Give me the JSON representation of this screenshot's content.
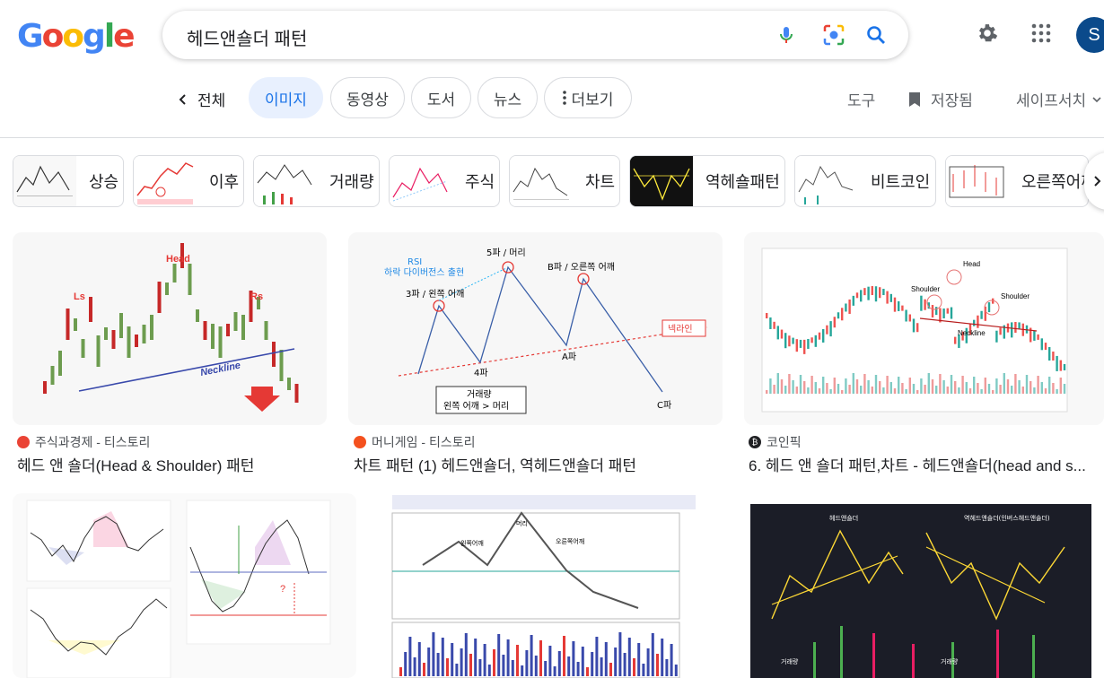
{
  "logo": {
    "letters": [
      "G",
      "o",
      "o",
      "g",
      "l",
      "e"
    ],
    "colors": [
      "#4285f4",
      "#ea4335",
      "#fbbc05",
      "#4285f4",
      "#34a853",
      "#ea4335"
    ]
  },
  "search": {
    "query": "헤드앤숄더 패턴"
  },
  "account": {
    "initial": "S",
    "color": "#0b4a8b"
  },
  "tabs": {
    "back_label": "전체",
    "items": [
      {
        "label": "이미지",
        "active": true
      },
      {
        "label": "동영상"
      },
      {
        "label": "도서"
      },
      {
        "label": "뉴스"
      },
      {
        "label": "더보기"
      }
    ],
    "tools": "도구",
    "saved": "저장됨",
    "safesearch": "세이프서치"
  },
  "chips": [
    "상승",
    "이후",
    "거래량",
    "주식",
    "차트",
    "역헤숄패턴",
    "비트코인",
    "오른쪽어깨"
  ],
  "results": [
    {
      "source": "주식과경제 - 티스토리",
      "title": "헤드 앤 숄더(Head & Shoulder) 패턴",
      "favicon_color": "#ea4335",
      "labels": {
        "head": "Head",
        "ls": "Ls",
        "rs": "Rs",
        "neckline": "Neckline"
      }
    },
    {
      "source": "머니게임 - 티스토리",
      "title": "차트 패턴 (1) 헤드앤숄더, 역헤드앤숄더 패턴",
      "favicon_color": "#f4511e",
      "labels": {
        "wave5": "5파 / 머리",
        "rsi": "RSI",
        "divergence": "하락 다이버전스 출현",
        "wave3": "3파 / 왼쪽 어깨",
        "waveB": "B파 / 오른쪽 어깨",
        "neckline": "넥라인",
        "wave4": "4파",
        "waveA": "A파",
        "waveC": "C파",
        "vol1": "거래량",
        "vol2": "왼쪽 어깨 > 머리"
      }
    },
    {
      "source": "코인픽",
      "title": "6. 헤드 앤 숄더 패턴,차트 - 헤드앤숄더(head and s...",
      "favicon_color": "#202124",
      "labels": {
        "head": "Head",
        "shoulder_l": "Shoulder",
        "shoulder_r": "Shoulder",
        "neckline": "Neckline"
      }
    },
    {
      "source": "",
      "title": ""
    },
    {
      "source": "",
      "title": "",
      "labels": {
        "head": "머리",
        "left": "왼쪽어깨",
        "right": "오른쪽어깨"
      }
    },
    {
      "source": "",
      "title": "",
      "labels": {
        "t1": "헤드앤숄더",
        "t2": "역헤드앤숄더(인버스헤드앤숄더)",
        "vol1": "거래량",
        "vol2": "거래량"
      }
    }
  ]
}
